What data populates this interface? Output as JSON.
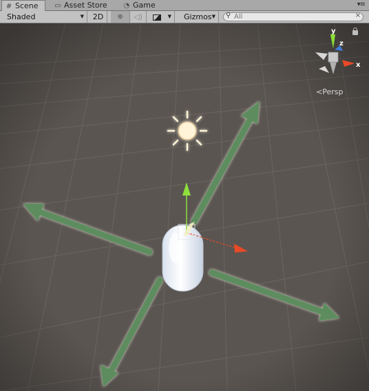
{
  "tabs": [
    {
      "label": "Scene",
      "icon": "hash-icon"
    },
    {
      "label": "Asset Store",
      "icon": "store-icon"
    },
    {
      "label": "Game",
      "icon": "pacman-icon"
    }
  ],
  "toolbar": {
    "draw_mode": "Shaded",
    "mode_2d": "2D",
    "gizmos": "Gizmos",
    "search_placeholder": "All"
  },
  "orientation_gizmo": {
    "y_label": "y",
    "z_label": "z",
    "x_label": "x",
    "projection": "Persp"
  },
  "colors": {
    "ground": "#5a5551",
    "move_arrow": "#5d8d5f",
    "y_axis": "#7ed321",
    "x_axis": "#e84a27",
    "z_axis": "#3f7dd9"
  }
}
